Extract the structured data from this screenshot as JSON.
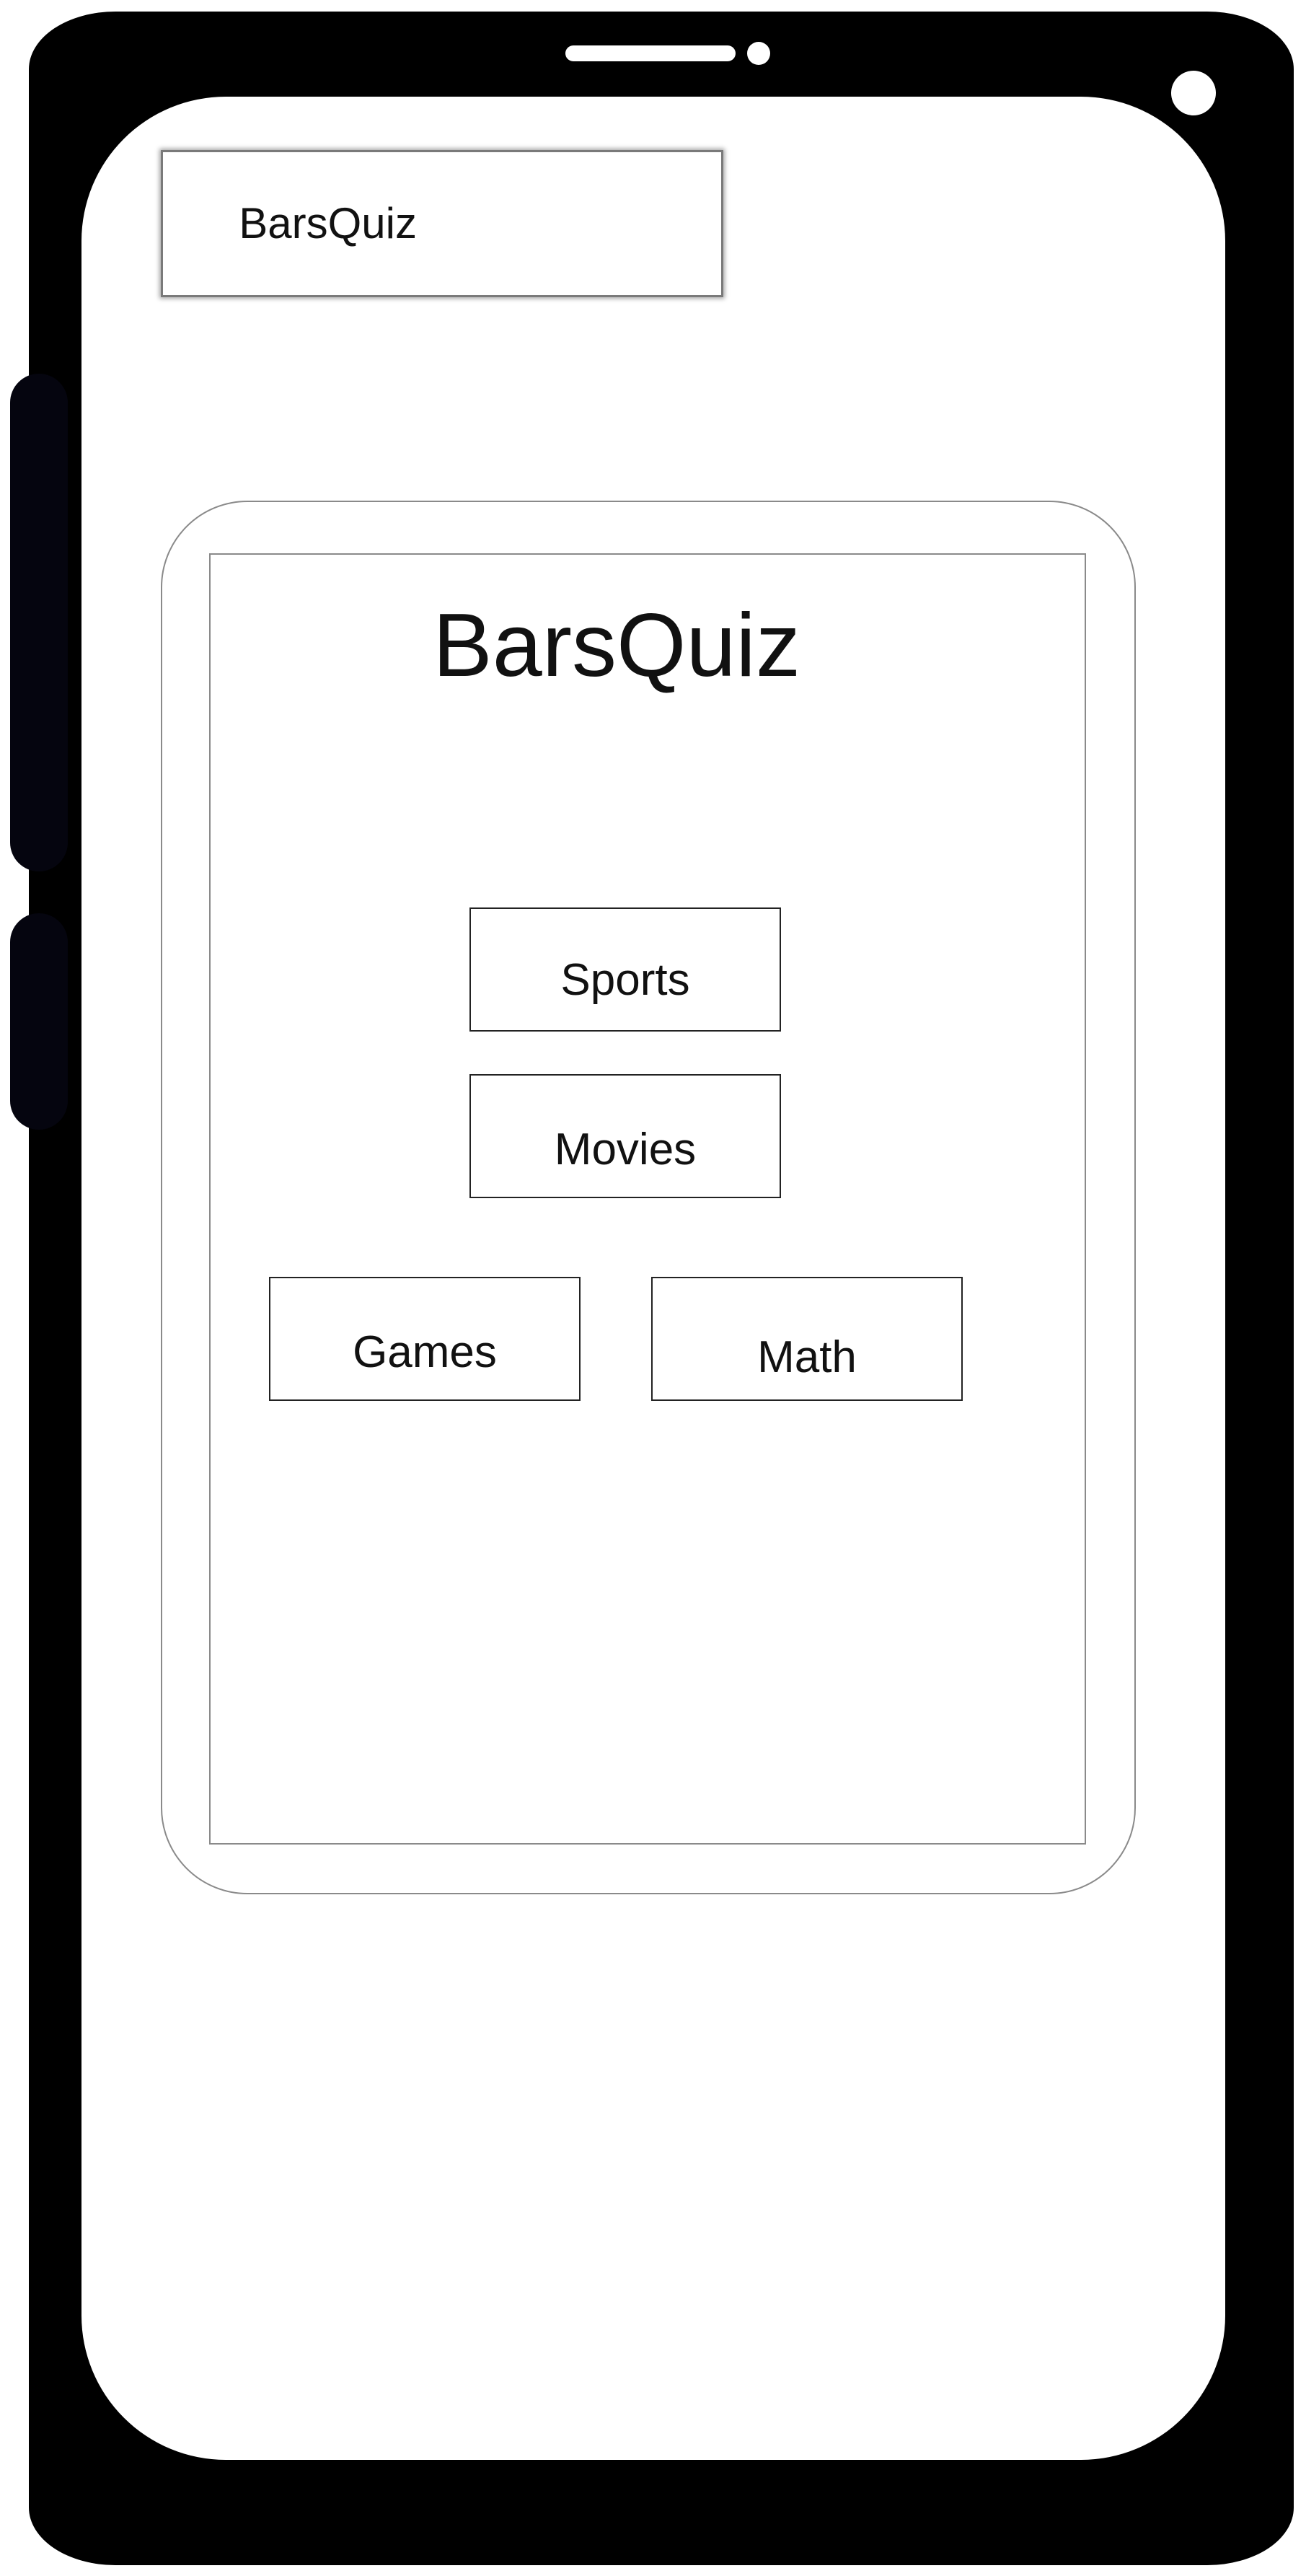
{
  "app_bar": {
    "title": "BarsQuiz"
  },
  "main": {
    "title": "BarsQuiz",
    "categories": [
      {
        "label": "Sports"
      },
      {
        "label": "Movies"
      },
      {
        "label": "Games"
      },
      {
        "label": "Math"
      }
    ]
  },
  "colors": {
    "phone_frame": "#000000",
    "screen_background": "#ffffff",
    "border": "#222222",
    "text": "#111111"
  }
}
